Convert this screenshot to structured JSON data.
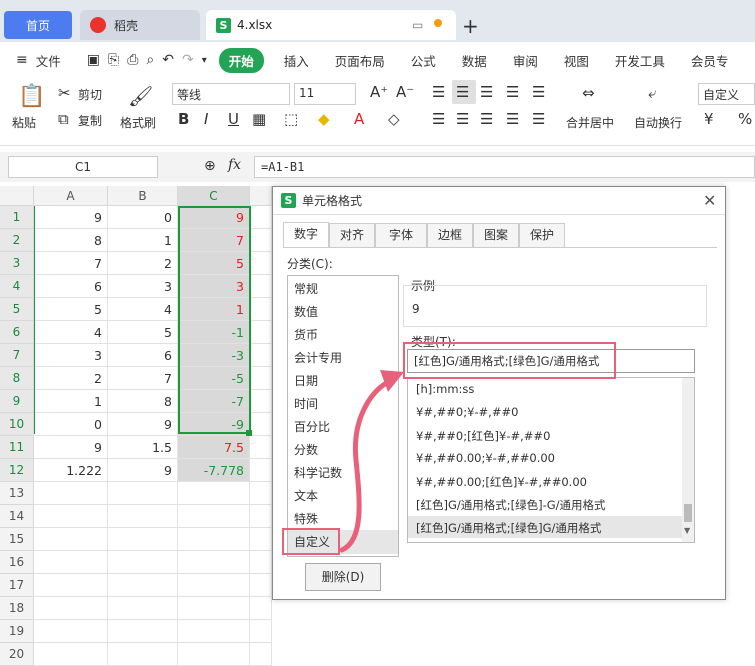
{
  "tabs": {
    "home": "首页",
    "wps": "稻壳",
    "file": "4.xlsx"
  },
  "menus": [
    "文件",
    "开始",
    "插入",
    "页面布局",
    "公式",
    "数据",
    "审阅",
    "视图",
    "开发工具",
    "会员专"
  ],
  "ribbon": {
    "paste": "粘贴",
    "cut": "剪切",
    "copy": "复制",
    "format_painter": "格式刷",
    "font_name": "等线",
    "font_size": "11",
    "merge": "合并居中",
    "wrap": "自动换行",
    "number_format": "自定义"
  },
  "formula_bar": {
    "cell_ref": "C1",
    "fx": "fx",
    "formula": "=A1-B1"
  },
  "columns": [
    "A",
    "B",
    "C"
  ],
  "rows": [
    {
      "n": "1",
      "a": "9",
      "b": "0",
      "c": "9",
      "neg": false
    },
    {
      "n": "2",
      "a": "8",
      "b": "1",
      "c": "7",
      "neg": false
    },
    {
      "n": "3",
      "a": "7",
      "b": "2",
      "c": "5",
      "neg": false
    },
    {
      "n": "4",
      "a": "6",
      "b": "3",
      "c": "3",
      "neg": false
    },
    {
      "n": "5",
      "a": "5",
      "b": "4",
      "c": "1",
      "neg": false
    },
    {
      "n": "6",
      "a": "4",
      "b": "5",
      "c": "-1",
      "neg": true
    },
    {
      "n": "7",
      "a": "3",
      "b": "6",
      "c": "-3",
      "neg": true
    },
    {
      "n": "8",
      "a": "2",
      "b": "7",
      "c": "-5",
      "neg": true
    },
    {
      "n": "9",
      "a": "1",
      "b": "8",
      "c": "-7",
      "neg": true
    },
    {
      "n": "10",
      "a": "0",
      "b": "9",
      "c": "-9",
      "neg": true
    },
    {
      "n": "11",
      "a": "9",
      "b": "1.5",
      "c": "7.5",
      "neg": false
    },
    {
      "n": "12",
      "a": "1.222",
      "b": "9",
      "c": "-7.778",
      "neg": true
    },
    {
      "n": "13",
      "a": "",
      "b": "",
      "c": "",
      "neg": false
    },
    {
      "n": "14",
      "a": "",
      "b": "",
      "c": "",
      "neg": false
    },
    {
      "n": "15",
      "a": "",
      "b": "",
      "c": "",
      "neg": false
    },
    {
      "n": "16",
      "a": "",
      "b": "",
      "c": "",
      "neg": false
    },
    {
      "n": "17",
      "a": "",
      "b": "",
      "c": "",
      "neg": false
    },
    {
      "n": "18",
      "a": "",
      "b": "",
      "c": "",
      "neg": false
    },
    {
      "n": "19",
      "a": "",
      "b": "",
      "c": "",
      "neg": false
    },
    {
      "n": "20",
      "a": "",
      "b": "",
      "c": "",
      "neg": false
    }
  ],
  "dialog": {
    "title": "单元格格式",
    "tabs": [
      "数字",
      "对齐",
      "字体",
      "边框",
      "图案",
      "保护"
    ],
    "category_label": "分类(C):",
    "categories": [
      "常规",
      "数值",
      "货币",
      "会计专用",
      "日期",
      "时间",
      "百分比",
      "分数",
      "科学记数",
      "文本",
      "特殊",
      "自定义"
    ],
    "sample_label": "示例",
    "sample_value": "9",
    "type_label": "类型(T):",
    "type_value": "[红色]G/通用格式;[绿色]G/通用格式",
    "type_list": [
      "[h]:mm:ss",
      "¥#,##0;¥-#,##0",
      "¥#,##0;[红色]¥-#,##0",
      "¥#,##0.00;¥-#,##0.00",
      "¥#,##0.00;[红色]¥-#,##0.00",
      "[红色]G/通用格式;[绿色]-G/通用格式",
      "[红色]G/通用格式;[绿色]G/通用格式"
    ],
    "delete_button": "删除(D)"
  },
  "colors": {
    "accent_green": "#23a455",
    "positive_red": "#e02020",
    "negative_green": "#1a9a3a",
    "annotation": "#e8617a"
  }
}
